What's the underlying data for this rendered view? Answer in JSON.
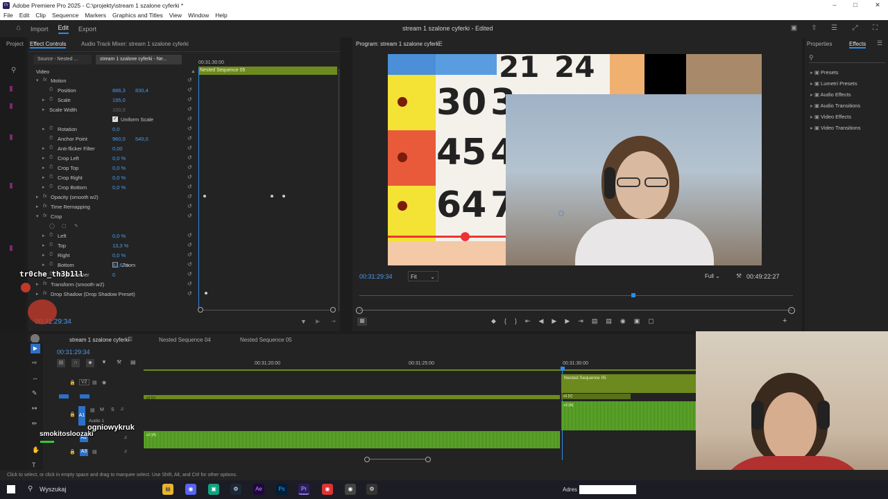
{
  "window": {
    "title": "Adobe Premiere Pro 2025 - C:\\projekty\\stream 1 szalone cyferki *",
    "app_icon": "Pr"
  },
  "menu": [
    "File",
    "Edit",
    "Clip",
    "Sequence",
    "Markers",
    "Graphics and Titles",
    "View",
    "Window",
    "Help"
  ],
  "header": {
    "workspaces": [
      "Import",
      "Edit",
      "Export"
    ],
    "active_workspace": "Edit",
    "doc_title": "stream 1 szalone cyferki - Edited"
  },
  "left_panel": {
    "tabs": [
      "Project",
      "Effect Controls",
      "Audio Track Mixer: stream 1 szalone cyferki"
    ],
    "source_tabs": [
      "Source - Nested ...",
      "stream 1 szalone cyferki - Ne..."
    ],
    "timecode": "00:31:30:00",
    "clip_name": "Nested Sequence 05",
    "section": "Video",
    "rows": [
      {
        "label": "Motion",
        "indent": 1,
        "fx": true,
        "open": true
      },
      {
        "label": "Position",
        "indent": 2,
        "v1": "886,3",
        "v2": "830,4",
        "tw": true
      },
      {
        "label": "Scale",
        "indent": 2,
        "v1": "195,0",
        "arrow": true,
        "tw": true
      },
      {
        "label": "Scale Width",
        "indent": 2,
        "v1": "100,0",
        "dim": true,
        "arrow": true
      },
      {
        "label": "Uniform Scale",
        "indent": 3,
        "checkbox": true
      },
      {
        "label": "Rotation",
        "indent": 2,
        "v1": "0,0",
        "arrow": true,
        "tw": true
      },
      {
        "label": "Anchor Point",
        "indent": 2,
        "v1": "960,0",
        "v2": "540,0",
        "tw": true
      },
      {
        "label": "Anti-flicker Filter",
        "indent": 2,
        "v1": "0,00",
        "arrow": true,
        "tw": true
      },
      {
        "label": "Crop Left",
        "indent": 2,
        "v1": "0,0 %",
        "arrow": true,
        "tw": true
      },
      {
        "label": "Crop Top",
        "indent": 2,
        "v1": "0,0 %",
        "arrow": true,
        "tw": true
      },
      {
        "label": "Crop Right",
        "indent": 2,
        "v1": "0,0 %",
        "arrow": true,
        "tw": true
      },
      {
        "label": "Crop Bottom",
        "indent": 2,
        "v1": "0,0 %",
        "arrow": true,
        "tw": true
      },
      {
        "label": "Opacity (smooth w2)",
        "indent": 1,
        "fx": true
      },
      {
        "label": "Time Remapping",
        "indent": 1,
        "fx": true
      },
      {
        "label": "Crop",
        "indent": 1,
        "fx": true,
        "open": true
      },
      {
        "label": "",
        "indent": 2,
        "shapes": true
      },
      {
        "label": "Left",
        "indent": 2,
        "v1": "0,0 %",
        "arrow": true,
        "tw": true
      },
      {
        "label": "Top",
        "indent": 2,
        "v1": "13,3 %",
        "arrow": true,
        "tw": true
      },
      {
        "label": "Right",
        "indent": 2,
        "v1": "0,0 %",
        "arrow": true,
        "tw": true
      },
      {
        "label": "Bottom",
        "indent": 2,
        "v1": "83,6 %",
        "arrow": true,
        "tw": true
      },
      {
        "label": "Edge Feather",
        "indent": 2,
        "v1": "0",
        "arrow": true,
        "tw": true
      },
      {
        "label": "Transform (smooth w2)",
        "indent": 1,
        "fx": true
      },
      {
        "label": "Drop Shadow (Drop Shadow Preset)",
        "indent": 1,
        "fx": true
      }
    ],
    "zoom_label": "Zoom",
    "current_time": "00:31:29:34"
  },
  "overlay_names": [
    "tr0che_th3b1ll",
    "smokitosloozaki",
    "ogniowykruk"
  ],
  "program": {
    "tab": "Program: stream 1 szalone cyferki",
    "timecode": "00:31:29:34",
    "fit": "Fit",
    "quality": "Full",
    "duration": "00:49:22:27",
    "numbers": [
      "21",
      "24",
      "30",
      "3",
      "45",
      "4",
      "64",
      "7"
    ]
  },
  "effects_panel": {
    "tabs": [
      "Properties",
      "Effects"
    ],
    "active_tab": "Effects",
    "items": [
      "Presets",
      "Lumetri Presets",
      "Audio Effects",
      "Audio Transitions",
      "Video Effects",
      "Video Transitions"
    ]
  },
  "timeline": {
    "tabs": [
      "stream 1 szalone cyferki",
      "Nested Sequence 04",
      "Nested Sequence 05"
    ],
    "timecode": "00:31:29:34",
    "ruler": [
      "00:31:20:00",
      "00:31:25:00",
      "00:31:30:00"
    ],
    "tracks": [
      "V2",
      "V1",
      "A1",
      "A2",
      "A3"
    ],
    "track_name_a1": "Audio 1",
    "clip_nested": "Nested Sequence 05",
    "clip_v": "s3 [V]",
    "clip_a": "s3 [A]",
    "clip_v2": "s3 [V]",
    "clip_a2": "s3 [A]"
  },
  "status": "Click to select, or click in empty space and drag to marquee select. Use Shift, Alt, and Ctrl for other options.",
  "taskbar": {
    "search": "Wyszukaj",
    "address_label": "Adres"
  },
  "colors": {
    "accent": "#2d8ceb",
    "clip_green": "#6d8a1e",
    "audio_green": "#5aa62a",
    "value_blue": "#4a9bf0"
  }
}
